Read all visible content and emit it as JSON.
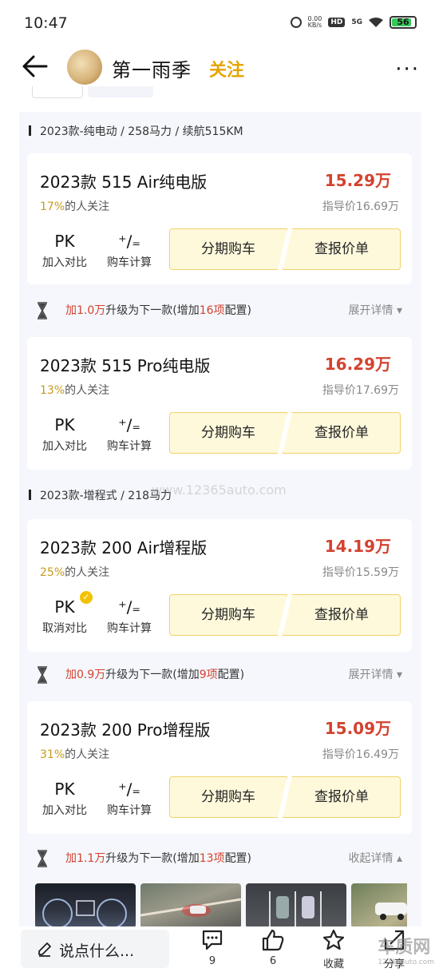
{
  "status_bar": {
    "time": "10:47",
    "net_speed": "0.00",
    "net_unit": "KB/s",
    "hd": "HD",
    "signal": "5G",
    "battery": "56"
  },
  "header": {
    "title": "第一雨季",
    "follow_label": "关注",
    "more_label": "···"
  },
  "sections": [
    {
      "label": "2023款-纯电动 / 258马力 / 续航515KM"
    },
    {
      "label": "2023款-增程式 / 218马力"
    }
  ],
  "cards": [
    {
      "name": "2023款 515 Air纯电版",
      "price": "15.29万",
      "attention_pct": "17%",
      "attention_suffix": "的人关注",
      "guide_price": "指导价16.69万",
      "pk_label": "PK",
      "pk_sub": "加入对比",
      "calc_label": "购车计算",
      "btn_installment": "分期购车",
      "btn_quote": "查报价单"
    },
    {
      "name": "2023款 515 Pro纯电版",
      "price": "16.29万",
      "attention_pct": "13%",
      "attention_suffix": "的人关注",
      "guide_price": "指导价17.69万",
      "pk_label": "PK",
      "pk_sub": "加入对比",
      "calc_label": "购车计算",
      "btn_installment": "分期购车",
      "btn_quote": "查报价单"
    },
    {
      "name": "2023款 200 Air增程版",
      "price": "14.19万",
      "attention_pct": "25%",
      "attention_suffix": "的人关注",
      "guide_price": "指导价15.59万",
      "pk_label": "PK",
      "pk_sub": "取消对比",
      "calc_label": "购车计算",
      "btn_installment": "分期购车",
      "btn_quote": "查报价单"
    },
    {
      "name": "2023款 200 Pro增程版",
      "price": "15.09万",
      "attention_pct": "31%",
      "attention_suffix": "的人关注",
      "guide_price": "指导价16.49万",
      "pk_label": "PK",
      "pk_sub": "加入对比",
      "calc_label": "购车计算",
      "btn_installment": "分期购车",
      "btn_quote": "查报价单"
    }
  ],
  "upgrades": [
    {
      "prefix": "加",
      "amount": "1.0万",
      "mid": "升级为下一款(增加",
      "count": "16项",
      "suffix": "配置)",
      "detail": "展开详情 ▾"
    },
    {
      "prefix": "加",
      "amount": "0.9万",
      "mid": "升级为下一款(增加",
      "count": "9项",
      "suffix": "配置)",
      "detail": "展开详情 ▾"
    },
    {
      "prefix": "加",
      "amount": "1.1万",
      "mid": "升级为下一款(增加",
      "count": "13项",
      "suffix": "配置)",
      "detail": "收起详情 ▴"
    }
  ],
  "watermark": "www.12365auto.com",
  "bottom_bar": {
    "comment_placeholder": "说点什么...",
    "comments_count": "9",
    "likes_count": "6",
    "favorite_label": "收藏",
    "share_label": "分享",
    "site_logo": "车质网",
    "site_url": "12365auto.com"
  },
  "colors": {
    "accent": "#e7a400",
    "price_red": "#d3422f",
    "button_bg": "#fff9dc",
    "panel_bg": "#f5f7fc"
  }
}
